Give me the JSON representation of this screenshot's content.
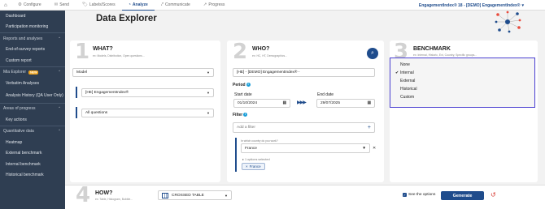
{
  "topnav": {
    "items": [
      {
        "label": "Configure",
        "icon": "gear-icon"
      },
      {
        "label": "Send",
        "icon": "send-icon"
      },
      {
        "label": "Labels/Scores",
        "icon": "tag-icon"
      },
      {
        "label": "Analyze",
        "icon": "analyze-icon"
      },
      {
        "label": "Communicate",
        "icon": "share-icon"
      },
      {
        "label": "Progress",
        "icon": "chart-icon"
      }
    ],
    "active": "Analyze",
    "project": "EngagementIndex® 18 - [DEMO] EngagementIndex®"
  },
  "sidebar": {
    "top_items": [
      "Dashboard",
      "Participation monitoring"
    ],
    "sections": [
      {
        "title": "Reports and analyses",
        "items": [
          "End-of-survey reports",
          "Custom report"
        ]
      },
      {
        "title": "Mia Explorer",
        "badge": "NEW",
        "items": [
          "Verbatim Analyses",
          "Analysis History (QA User Only)"
        ]
      },
      {
        "title": "Areas of progress",
        "items": [
          "Key actions"
        ]
      },
      {
        "title": "Quantitative data",
        "items": [
          "Heatmap",
          "External benchmark",
          "Internal benchmark",
          "Historical benchmark"
        ]
      }
    ]
  },
  "page": {
    "title": "Data Explorer"
  },
  "what": {
    "num": "1",
    "title": "WHAT?",
    "subtitle": "ex: Models, Distribution, Open questions...",
    "model": "Model",
    "survey": "[HE] EngagementIndex®",
    "questions": "All questions"
  },
  "who": {
    "num": "2",
    "title": "WHO?",
    "subtitle": "ex: HC, HT, Demographics...",
    "project": "[HE] - [DEMO] EngagementIndex® -",
    "period_label": "Period",
    "start_label": "Start date",
    "start": "01/10/2024",
    "end_label": "End date",
    "end": "29/07/2025",
    "filter_label": "Filter",
    "filter_placeholder": "Add a filter",
    "condition": "In which country do you work?",
    "country": "France",
    "options_selected": "1 options selected",
    "chip": "France"
  },
  "benchmark": {
    "num": "3",
    "title": "BENCHMARK",
    "subtitle": "ex: Internal, Historic, Ext, Country, Specific groups...",
    "options": [
      "None",
      "Internal",
      "External",
      "Historical",
      "Custom"
    ],
    "selected": "Internal"
  },
  "how": {
    "num": "4",
    "title": "HOW?",
    "subtitle": "ex: Table, Histogram, Bubble...",
    "view": "CROSSED TABLE",
    "see_options": "See the options",
    "generate": "Generate"
  },
  "colors": {
    "primary": "#1f4c8c",
    "sidebar": "#2f3e52",
    "highlight": "#4a3fd1",
    "badge": "#f0a31b",
    "reset": "#d6342c"
  }
}
